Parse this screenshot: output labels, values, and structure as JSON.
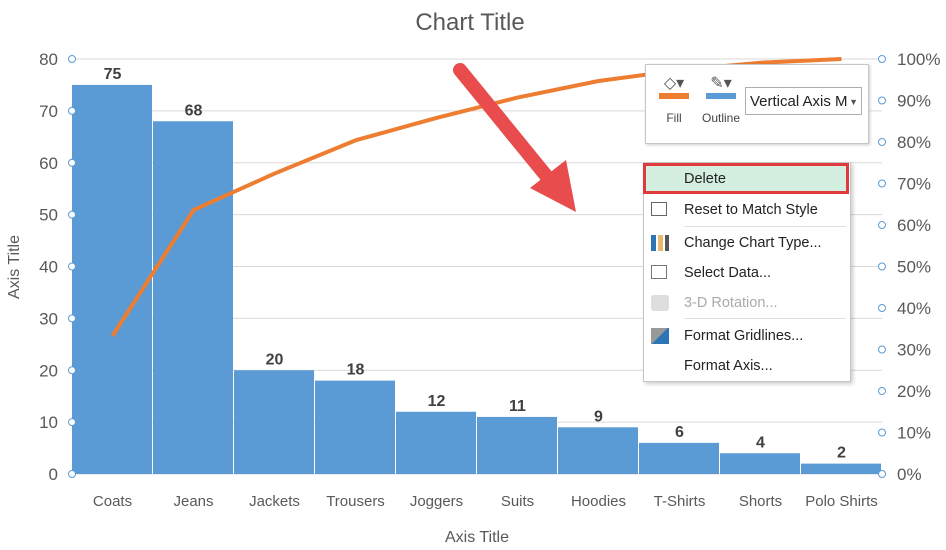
{
  "chart_data": {
    "type": "bar+line",
    "title": "Chart Title",
    "xlabel": "Axis Title",
    "ylabel": "Axis Title",
    "categories": [
      "Coats",
      "Jeans",
      "Jackets",
      "Trousers",
      "Joggers",
      "Suits",
      "Hoodies",
      "T-Shirts",
      "Shorts",
      "Polo Shirts"
    ],
    "series": [
      {
        "type": "bar",
        "values": [
          75,
          68,
          20,
          18,
          12,
          11,
          9,
          6,
          4,
          2
        ],
        "color": "#5b9bd5"
      },
      {
        "type": "line",
        "axis": "secondary",
        "values": [
          33.3,
          63.6,
          72.4,
          80.4,
          85.8,
          90.7,
          94.7,
          97.3,
          99.1,
          100
        ],
        "color": "#ed7d31"
      }
    ],
    "ylim": [
      0,
      80
    ],
    "yticks": [
      "0",
      "10",
      "20",
      "30",
      "40",
      "50",
      "60",
      "70",
      "80"
    ],
    "y2lim": [
      0,
      100
    ],
    "y2ticks": [
      "0%",
      "10%",
      "20%",
      "30%",
      "40%",
      "50%",
      "60%",
      "70%",
      "80%",
      "90%",
      "100%"
    ],
    "grid": true
  },
  "toolbar": {
    "fill_label": "Fill",
    "outline_label": "Outline",
    "fill_color": "#ed7d31",
    "outline_color": "#5b9bd5",
    "element_select": "Vertical Axis M"
  },
  "menu": {
    "items": [
      {
        "label": "Delete",
        "icon": "none"
      },
      {
        "label": "Reset to Match Style",
        "icon": "reset-style-icon"
      },
      {
        "label": "Change Chart Type...",
        "icon": "chart-type-icon"
      },
      {
        "label": "Select Data...",
        "icon": "select-data-icon"
      },
      {
        "label": "3-D Rotation...",
        "icon": "3d-rotation-icon",
        "disabled": true
      },
      {
        "label": "Format Gridlines...",
        "icon": "format-gridlines-icon"
      },
      {
        "label": "Format Axis...",
        "icon": "none"
      }
    ]
  },
  "annotation": {
    "arrow_color": "#e84c4c"
  }
}
